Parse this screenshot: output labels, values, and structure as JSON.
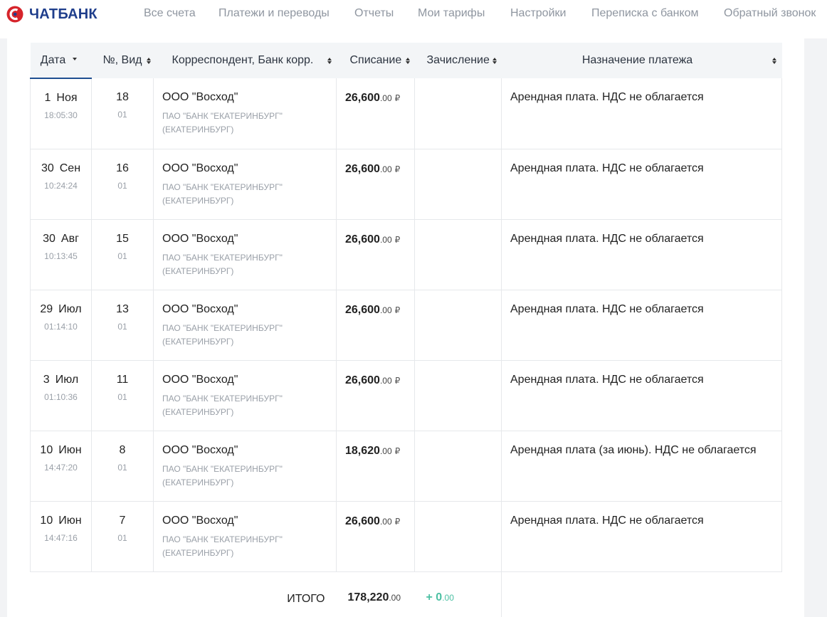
{
  "brand": {
    "name": "ЧАТБАНК",
    "logo_color": "#d6242b",
    "text_color": "#1f3e8c"
  },
  "nav": [
    {
      "label": "Все счета"
    },
    {
      "label": "Платежи и переводы"
    },
    {
      "label": "Отчеты"
    },
    {
      "label": "Мои тарифы"
    },
    {
      "label": "Настройки"
    },
    {
      "label": "Переписка с банком"
    },
    {
      "label": "Обратный звонок"
    }
  ],
  "table": {
    "headers": {
      "date": "Дата",
      "num": "№, Вид",
      "corr": "Корреспондент, Банк корр.",
      "debit": "Списание",
      "credit": "Зачисление",
      "purpose": "Назначение платежа"
    },
    "rows": [
      {
        "day": "1",
        "month": "Ноя",
        "time": "18:05:30",
        "num": "18",
        "type": "01",
        "corr": "ООО \"Восход\"",
        "bank": "ПАО \"БАНК \"ЕКАТЕРИНБУРГ\" (ЕКАТЕРИНБУРГ)",
        "debit_int": "26,600",
        "debit_dec": ".00",
        "currency": "₽",
        "purpose": "Арендная плата. НДС не облагается"
      },
      {
        "day": "30",
        "month": "Сен",
        "time": "10:24:24",
        "num": "16",
        "type": "01",
        "corr": "ООО \"Восход\"",
        "bank": "ПАО \"БАНК \"ЕКАТЕРИНБУРГ\" (ЕКАТЕРИНБУРГ)",
        "debit_int": "26,600",
        "debit_dec": ".00",
        "currency": "₽",
        "purpose": "Арендная плата. НДС не облагается"
      },
      {
        "day": "30",
        "month": "Авг",
        "time": "10:13:45",
        "num": "15",
        "type": "01",
        "corr": "ООО \"Восход\"",
        "bank": "ПАО \"БАНК \"ЕКАТЕРИНБУРГ\" (ЕКАТЕРИНБУРГ)",
        "debit_int": "26,600",
        "debit_dec": ".00",
        "currency": "₽",
        "purpose": "Арендная плата. НДС не облагается"
      },
      {
        "day": "29",
        "month": "Июл",
        "time": "01:14:10",
        "num": "13",
        "type": "01",
        "corr": "ООО \"Восход\"",
        "bank": "ПАО \"БАНК \"ЕКАТЕРИНБУРГ\" (ЕКАТЕРИНБУРГ)",
        "debit_int": "26,600",
        "debit_dec": ".00",
        "currency": "₽",
        "purpose": "Арендная плата. НДС не облагается"
      },
      {
        "day": "3",
        "month": "Июл",
        "time": "01:10:36",
        "num": "11",
        "type": "01",
        "corr": "ООО \"Восход\"",
        "bank": "ПАО \"БАНК \"ЕКАТЕРИНБУРГ\" (ЕКАТЕРИНБУРГ)",
        "debit_int": "26,600",
        "debit_dec": ".00",
        "currency": "₽",
        "purpose": "Арендная плата. НДС не облагается"
      },
      {
        "day": "10",
        "month": "Июн",
        "time": "14:47:20",
        "num": "8",
        "type": "01",
        "corr": "ООО \"Восход\"",
        "bank": "ПАО \"БАНК \"ЕКАТЕРИНБУРГ\" (ЕКАТЕРИНБУРГ)",
        "debit_int": "18,620",
        "debit_dec": ".00",
        "currency": "₽",
        "purpose": "Арендная плата (за июнь). НДС не облагается"
      },
      {
        "day": "10",
        "month": "Июн",
        "time": "14:47:16",
        "num": "7",
        "type": "01",
        "corr": "ООО \"Восход\"",
        "bank": "ПАО \"БАНК \"ЕКАТЕРИНБУРГ\" (ЕКАТЕРИНБУРГ)",
        "debit_int": "26,600",
        "debit_dec": ".00",
        "currency": "₽",
        "purpose": "Арендная плата. НДС не облагается"
      }
    ],
    "totals": {
      "label": "ИТОГО",
      "debit_int": "178,220",
      "debit_dec": ".00",
      "credit_sign": "+",
      "credit_int": "0",
      "credit_dec": ".00",
      "credit_color": "#4cc0a3"
    }
  }
}
